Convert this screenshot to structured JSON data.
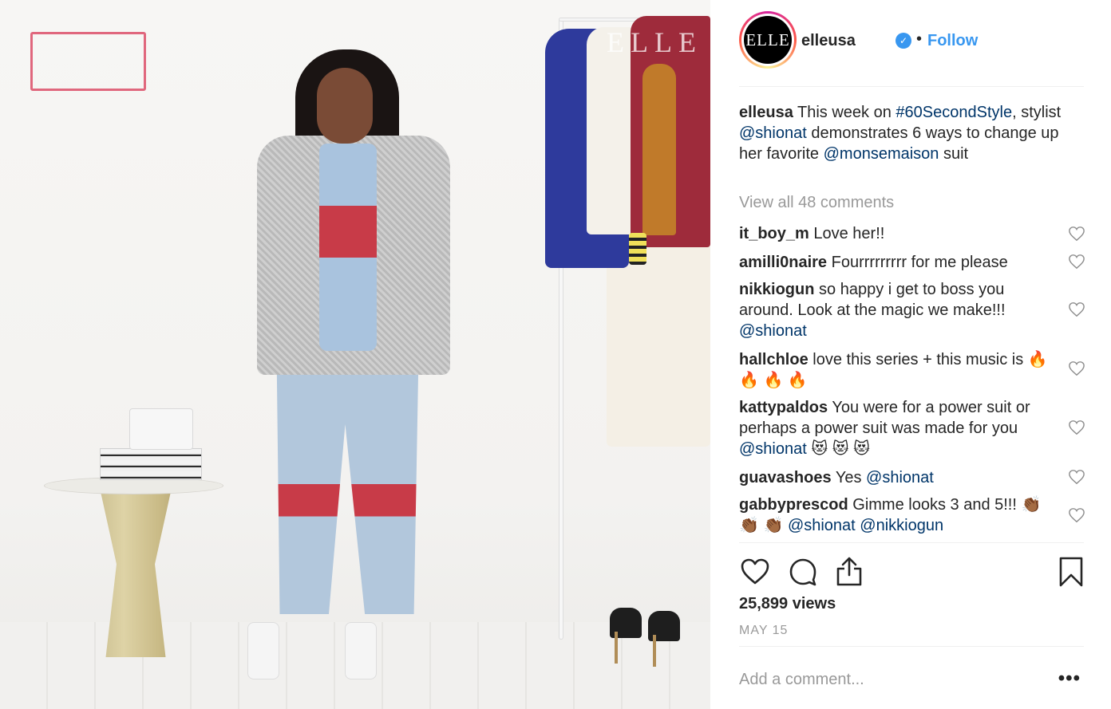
{
  "post": {
    "username": "elleusa",
    "avatar_text": "ELLE",
    "separator": "•",
    "follow_label": "Follow",
    "caption": {
      "username": "elleusa",
      "text_1": " This week on ",
      "hashtag": "#60SecondStyle",
      "text_2": ", stylist ",
      "mention_1": "@shionat",
      "text_3": " demonstrates 6 ways to change up her favorite ",
      "mention_2": "@monsemaison",
      "text_4": " suit"
    },
    "view_all_comments": "View all 48 comments",
    "comments": [
      {
        "user": "it_boy_m",
        "text": "Love her!!",
        "mention": "",
        "emoji": ""
      },
      {
        "user": "amilli0naire",
        "text": "Fourrrrrrrrr for me please",
        "mention": "",
        "emoji": ""
      },
      {
        "user": "nikkiogun",
        "text": "so happy i get to boss you around. Look at the magic we make!!!",
        "mention": "@shionat",
        "emoji": ""
      },
      {
        "user": "hallchloe",
        "text": "love this series + this music is",
        "mention": "",
        "emoji": "🔥 🔥 🔥 🔥"
      },
      {
        "user": "kattypaldos",
        "text": "You were for a power suit or perhaps a power suit was made for you",
        "mention": "@shionat",
        "emoji": "😻 😻 😻"
      },
      {
        "user": "guavashoes",
        "text": "Yes",
        "mention": "@shionat",
        "emoji": ""
      },
      {
        "user": "gabbyprescod",
        "text": "Gimme looks 3 and 5!!!",
        "mention": "@shionat @nikkiogun",
        "emoji": "👏🏾 👏🏾 👏🏾"
      }
    ],
    "views": "25,899 views",
    "date": "MAY 15",
    "add_comment_placeholder": "Add a comment...",
    "more_label": "•••",
    "icons": [
      "heart-icon",
      "comment-icon",
      "share-icon",
      "bookmark-icon",
      "verified-badge-icon"
    ],
    "colors": {
      "link": "#003569",
      "follow": "#3897f0",
      "muted": "#999999",
      "text": "#262626"
    }
  },
  "media": {
    "watermark": "ELLE"
  }
}
